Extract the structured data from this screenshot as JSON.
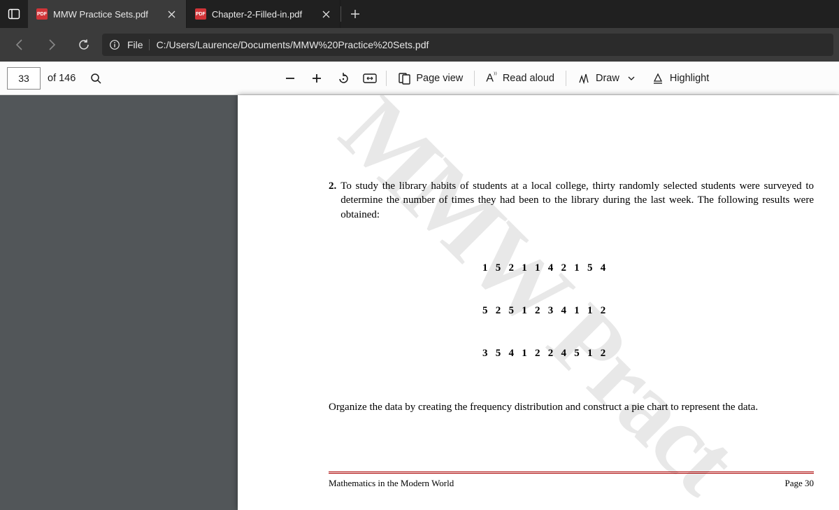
{
  "tabs": [
    {
      "label": "MMW Practice Sets.pdf",
      "active": true
    },
    {
      "label": "Chapter-2-Filled-in.pdf",
      "active": false
    }
  ],
  "addr": {
    "file_label": "File",
    "url": "C:/Users/Laurence/Documents/MMW%20Practice%20Sets.pdf"
  },
  "toolbar": {
    "page_current": "33",
    "page_total": "of 146",
    "page_view": "Page view",
    "read_aloud": "Read aloud",
    "draw": "Draw",
    "highlight": "Highlight"
  },
  "doc": {
    "watermark": "MMW Pract",
    "q_num": "2.",
    "q_text": "To study the library habits of students at a local college, thirty randomly selected students were surveyed to determine the number of times they had been to the library during the last week. The following results were obtained:",
    "data_rows": [
      "1   5   2   1   1   4   2   1   5   4",
      "5   2   5   1   2   3   4   1   1   2",
      "3   5   4   1   2   2   4   5   1   2"
    ],
    "instruction": "Organize the data by creating the frequency distribution and construct a pie chart to represent the data.",
    "footer_left": "Mathematics in the Modern World",
    "footer_right": "Page  30"
  }
}
